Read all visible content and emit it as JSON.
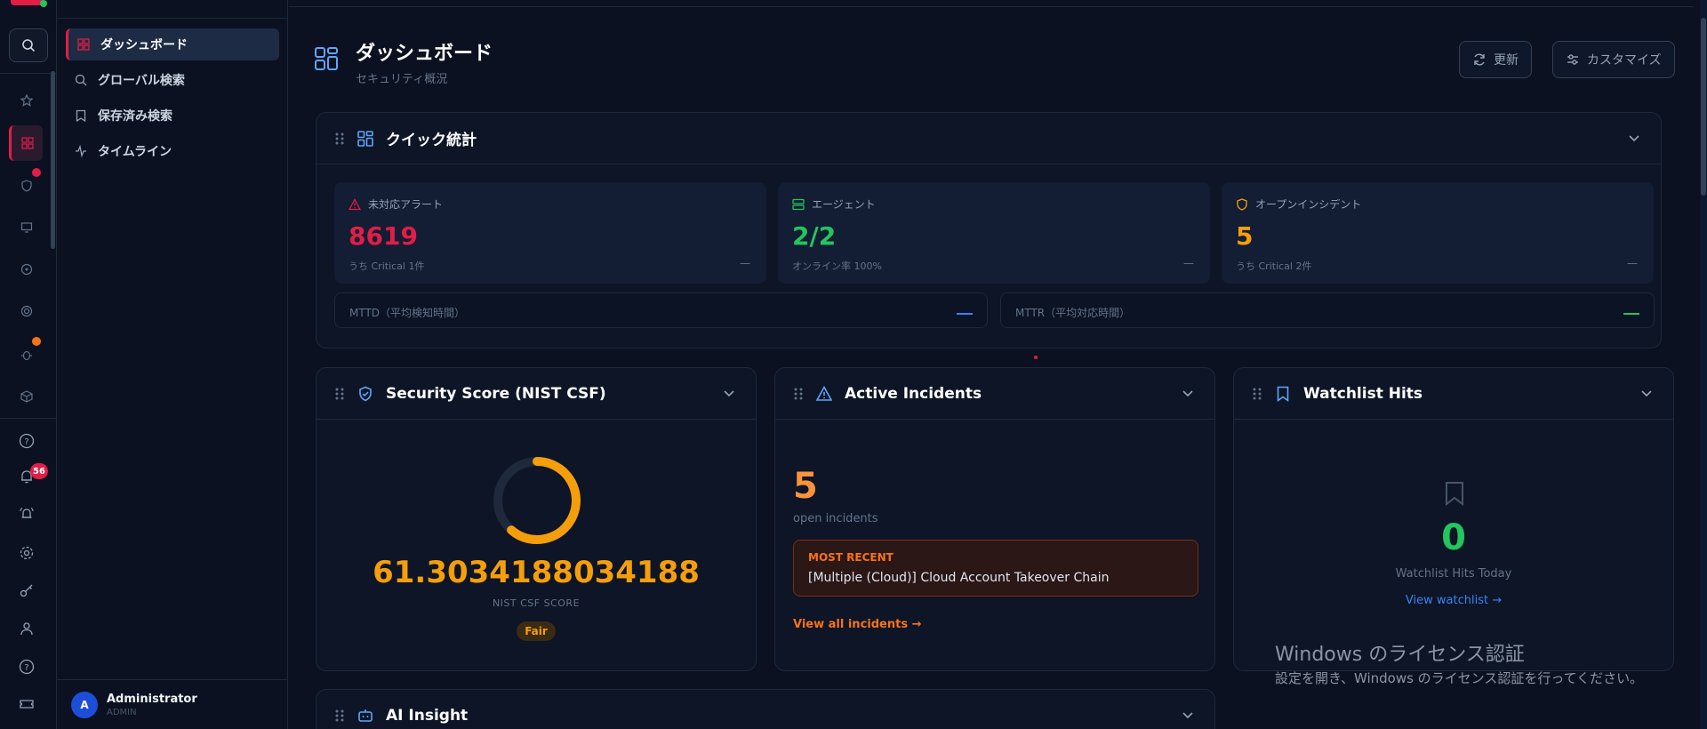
{
  "nav": {
    "items": [
      {
        "label": "ダッシュボード",
        "icon": "grid-icon"
      },
      {
        "label": "グローバル検索",
        "icon": "search-icon"
      },
      {
        "label": "保存済み検索",
        "icon": "bookmark-icon"
      },
      {
        "label": "タイムライン",
        "icon": "activity-icon"
      }
    ],
    "user": {
      "initial": "A",
      "name": "Administrator",
      "role": "ADMIN"
    }
  },
  "rail": {
    "notification_count": "56"
  },
  "header": {
    "title": "ダッシュボード",
    "subtitle": "セキュリティ概況",
    "refresh_label": "更新",
    "customize_label": "カスタマイズ"
  },
  "quick_stats": {
    "title": "クイック統計",
    "alerts": {
      "label": "未対応アラート",
      "value": "8619",
      "sub": "うち Critical 1件",
      "dash": "—"
    },
    "agents": {
      "label": "エージェント",
      "value": "2/2",
      "sub": "オンライン率 100%",
      "dash": "—"
    },
    "incidents": {
      "label": "オープンインシデント",
      "value": "5",
      "sub": "うち Critical 2件",
      "dash": "—"
    },
    "mttd": {
      "label": "MTTD（平均検知時間）"
    },
    "mttr": {
      "label": "MTTR（平均対応時間）"
    }
  },
  "security_score": {
    "title": "Security Score (NIST CSF)",
    "value": "61.3034188034188",
    "caption": "NIST CSF SCORE",
    "rating": "Fair",
    "ratio": 0.613
  },
  "active_incidents": {
    "title": "Active Incidents",
    "count": "5",
    "count_label": "open incidents",
    "recent_label": "MOST RECENT",
    "recent_title": "[Multiple (Cloud)] Cloud Account Takeover Chain",
    "link": "View all incidents →"
  },
  "watchlist": {
    "title": "Watchlist Hits",
    "count": "0",
    "count_label": "Watchlist Hits Today",
    "link": "View watchlist →"
  },
  "ai_insight": {
    "title": "AI Insight"
  },
  "watermark": {
    "line1": "Windows のライセンス認証",
    "line2": "設定を開き、Windows のライセンス認証を行ってください。"
  },
  "colors": {
    "accent": "#e11d48",
    "blue": "#3b82f6",
    "green": "#22c55e",
    "orange": "#f59e0b"
  }
}
